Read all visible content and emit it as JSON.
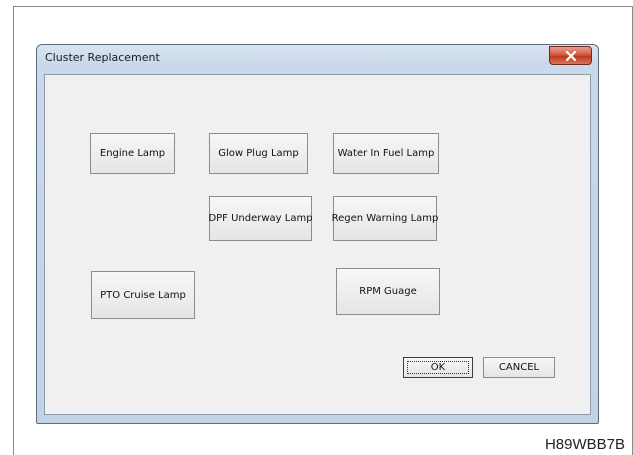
{
  "window": {
    "title": "Cluster Replacement",
    "close_label": "x"
  },
  "buttons": {
    "engine_lamp": "Engine Lamp",
    "glow_plug_lamp": "Glow Plug Lamp",
    "water_in_fuel_lamp": "Water In Fuel Lamp",
    "dpf_underway_lamp": "DPF Underway Lamp",
    "regen_warning_lamp": "Regen Warning Lamp",
    "pto_cruise_lamp": "PTO Cruise Lamp",
    "rpm_guage": "RPM Guage",
    "ok": "OK",
    "cancel": "CANCEL"
  },
  "figure_id": "H89WBB7B"
}
